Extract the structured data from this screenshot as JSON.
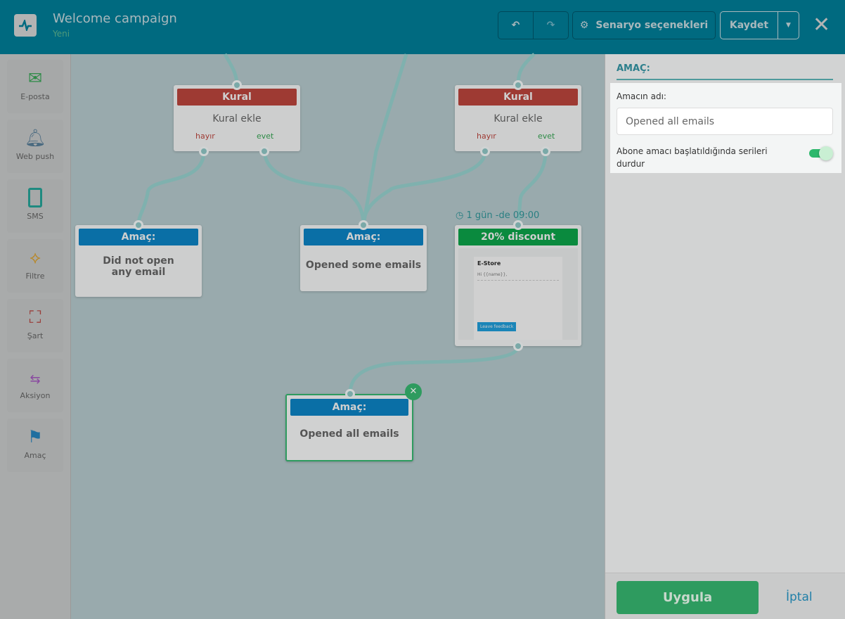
{
  "header": {
    "title": "Welcome campaign",
    "status": "Yeni",
    "undo": "undo-icon",
    "redo": "redo-icon",
    "options_label": "Senaryo seçenekleri",
    "save_label": "Kaydet"
  },
  "sidebar": {
    "items": [
      {
        "label": "E-posta",
        "icon": "email-icon",
        "color": "#2e8b47"
      },
      {
        "label": "Web push",
        "icon": "bell-icon",
        "color": "#4a6a80"
      },
      {
        "label": "SMS",
        "icon": "phone-icon",
        "color": "#1f8a80"
      },
      {
        "label": "Filtre",
        "icon": "filter-icon",
        "color": "#b9851f"
      },
      {
        "label": "Şart",
        "icon": "condition-icon",
        "color": "#9a3e3a"
      },
      {
        "label": "Aksiyon",
        "icon": "action-icon",
        "color": "#8a4aa0"
      },
      {
        "label": "Amaç",
        "icon": "goal-flag-icon",
        "color": "#1f6fa0"
      }
    ]
  },
  "canvas": {
    "rules": [
      {
        "title": "Kural",
        "body": "Kural ekle",
        "no": "hayır",
        "yes": "evet"
      },
      {
        "title": "Kural",
        "body": "Kural ekle",
        "no": "hayır",
        "yes": "evet"
      }
    ],
    "goals": [
      {
        "title": "Amaç:",
        "body": "Did not open any email"
      },
      {
        "title": "Amaç:",
        "body": "Opened some emails"
      },
      {
        "title": "Amaç:",
        "body": "Opened all emails"
      }
    ],
    "email": {
      "delay": "1 gün -de 09:00",
      "title": "20% discount",
      "brand": "E-Store",
      "greeting": "Hi {{name}},",
      "button": "Leave feedback"
    },
    "colors": {
      "rule": "#9e3a33",
      "goal": "#0a6fa6",
      "email": "#0a8a3e",
      "line": "#7fb1ae"
    }
  },
  "panel": {
    "section": "AMAÇ:",
    "name_label": "Amacın adı:",
    "name_value": "Opened all emails",
    "toggle_label": "Abone amacı başlatıldığında serileri durdur",
    "toggle_on": true,
    "apply": "Uygula",
    "cancel": "İptal"
  }
}
